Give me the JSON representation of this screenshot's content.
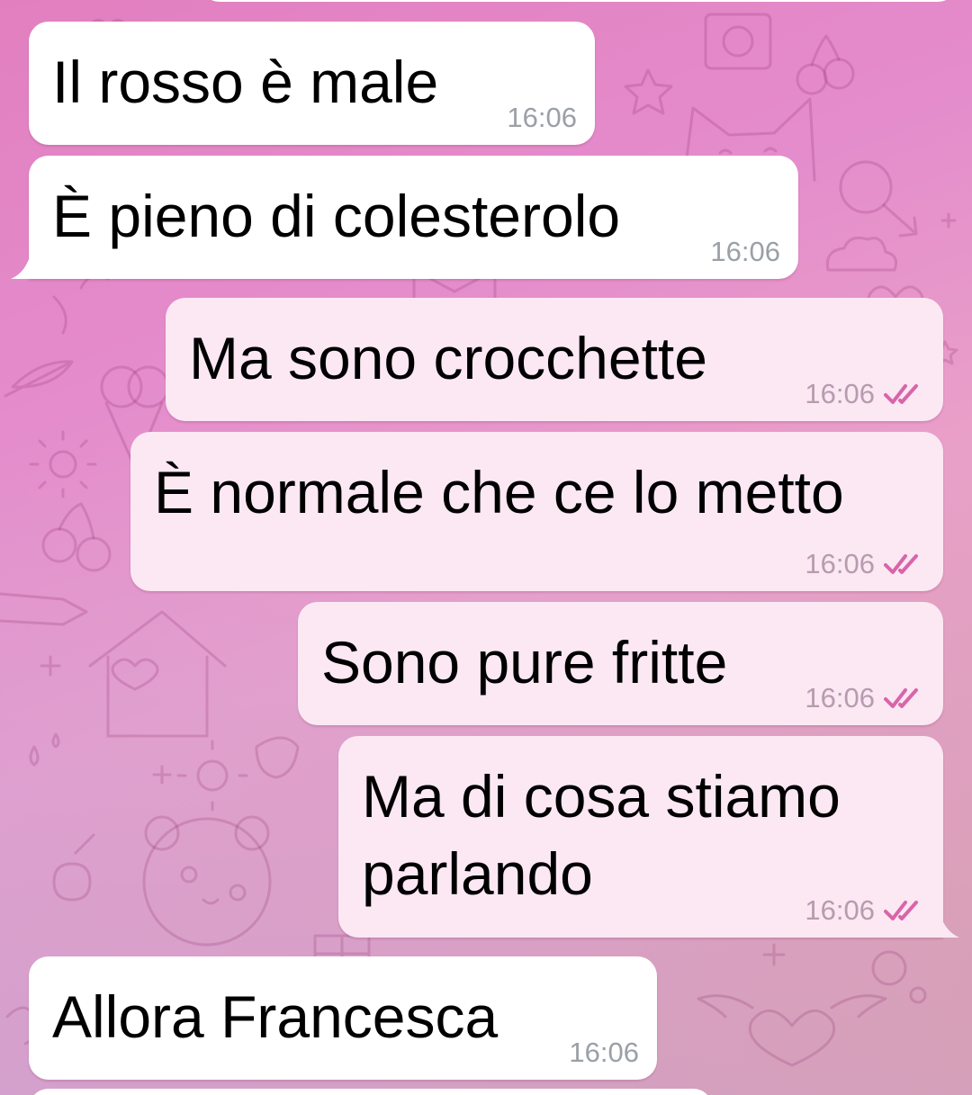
{
  "chat": {
    "messages": [
      {
        "id": "m1",
        "direction": "incoming",
        "text": "Il rosso è male",
        "time": "16:06"
      },
      {
        "id": "m2",
        "direction": "incoming",
        "text": "È pieno di colesterolo",
        "time": "16:06"
      },
      {
        "id": "m3",
        "direction": "outgoing",
        "text": "Ma sono crocchette",
        "time": "16:06",
        "status": "read"
      },
      {
        "id": "m4",
        "direction": "outgoing",
        "text": "È normale che ce lo metto",
        "time": "16:06",
        "status": "read"
      },
      {
        "id": "m5",
        "direction": "outgoing",
        "text": "Sono pure fritte",
        "time": "16:06",
        "status": "read"
      },
      {
        "id": "m6",
        "direction": "outgoing",
        "text": "Ma di cosa stiamo\nparlando",
        "time": "16:06",
        "status": "read"
      },
      {
        "id": "m7",
        "direction": "incoming",
        "text": "Allora Francesca",
        "time": "16:06"
      }
    ]
  },
  "theme": {
    "incoming_bubble": "#ffffff",
    "outgoing_bubble": "#fbe8f3",
    "read_check_color": "#d865a9",
    "background": "pink-purple gradient with doodle pattern"
  },
  "icons": {
    "read_status": "double-check-icon"
  }
}
